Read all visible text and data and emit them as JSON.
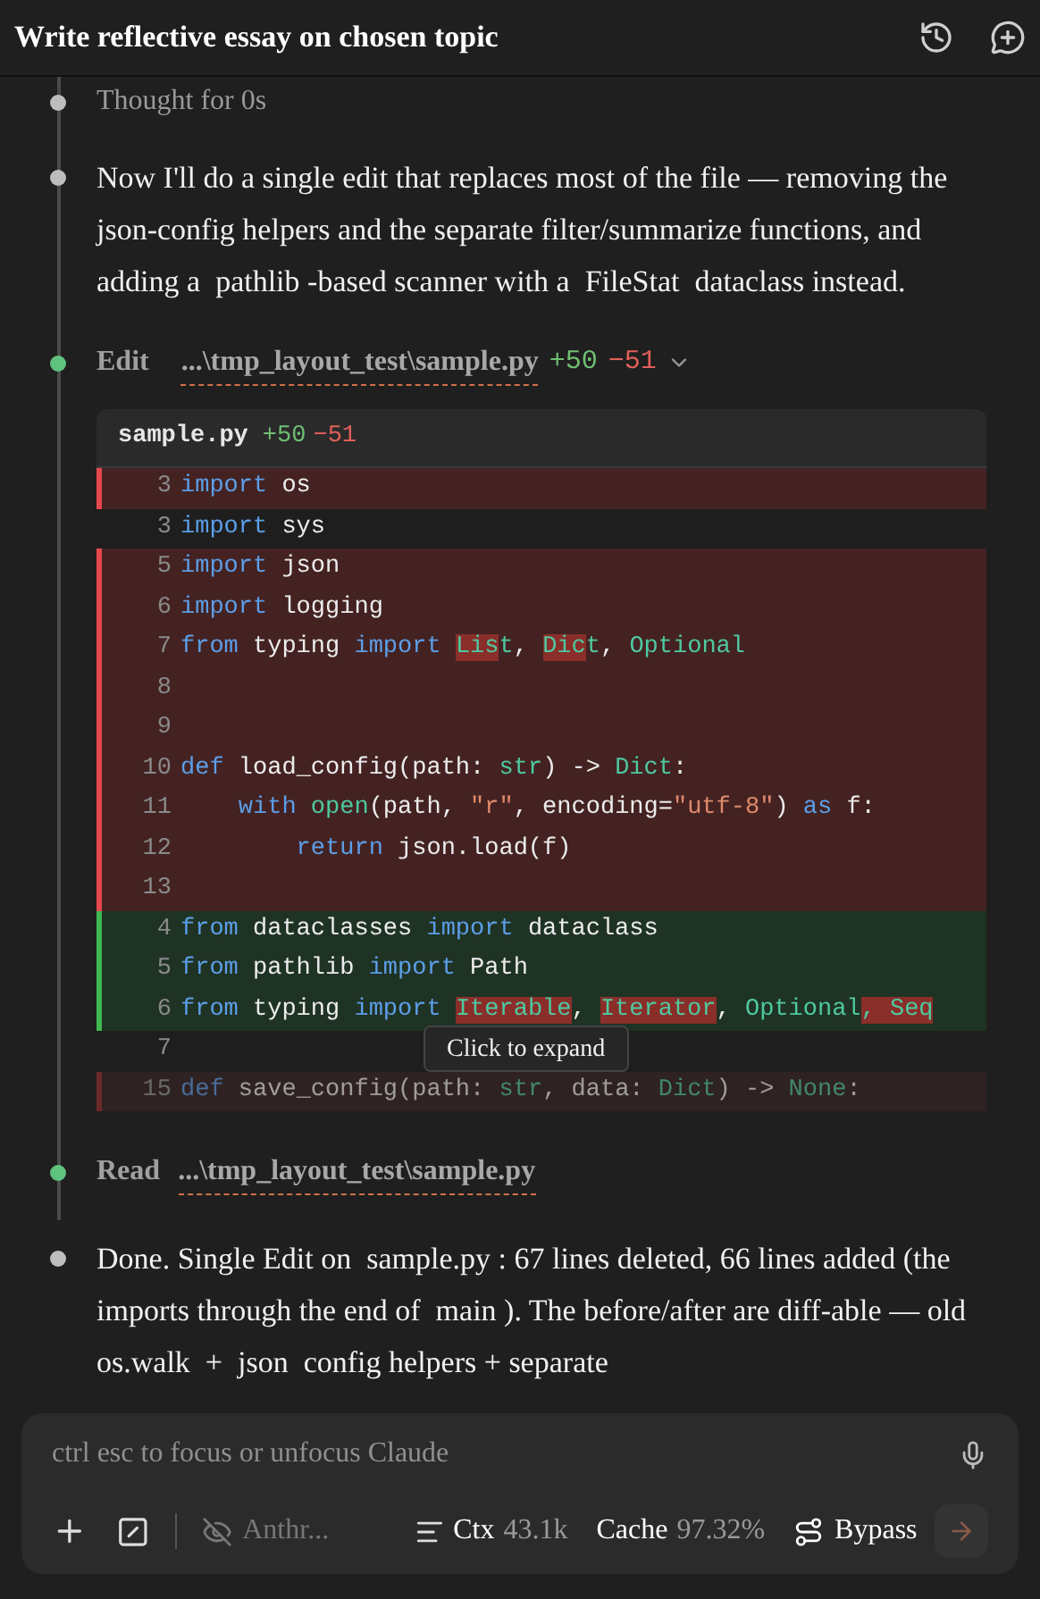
{
  "header": {
    "title": "Write reflective essay on chosen topic"
  },
  "timeline": [
    {
      "kind": "thought",
      "label": "Thought for 0s"
    },
    {
      "kind": "message",
      "text": "Now I'll do a single edit that replaces most of the file — removing the json-config helpers and the separate filter/summarize functions, and adding a  pathlib -based scanner with a  FileStat  dataclass instead."
    },
    {
      "kind": "edit",
      "action": "Edit",
      "path": "...\\tmp_layout_test\\sample.py",
      "added": "+50",
      "removed": "−51",
      "diff": {
        "file": "sample.py",
        "added": "+50",
        "removed": "−51",
        "expand_label": "Click to expand",
        "lines": [
          {
            "num": "3",
            "kind": "removed",
            "tokens": [
              {
                "text": "import",
                "kind": "kw"
              },
              {
                "text": " os",
                "kind": "txt"
              }
            ]
          },
          {
            "num": "3",
            "kind": "context",
            "tokens": [
              {
                "text": "import",
                "kind": "kw"
              },
              {
                "text": " sys",
                "kind": "txt"
              }
            ]
          },
          {
            "num": "5",
            "kind": "removed",
            "tokens": [
              {
                "text": "import",
                "kind": "kw"
              },
              {
                "text": " json",
                "kind": "txt"
              }
            ]
          },
          {
            "num": "6",
            "kind": "removed",
            "tokens": [
              {
                "text": "import",
                "kind": "kw"
              },
              {
                "text": " logging",
                "kind": "txt"
              }
            ]
          },
          {
            "num": "7",
            "kind": "removed",
            "tokens": [
              {
                "text": "from",
                "kind": "kw"
              },
              {
                "text": " typing ",
                "kind": "txt"
              },
              {
                "text": "import ",
                "kind": "kw"
              },
              {
                "text": "Lis",
                "kind": "hl"
              },
              {
                "text": "t",
                "kind": "ty"
              },
              {
                "text": ", ",
                "kind": "txt"
              },
              {
                "text": "Dic",
                "kind": "hl"
              },
              {
                "text": "t",
                "kind": "ty"
              },
              {
                "text": ", ",
                "kind": "txt"
              },
              {
                "text": "Optional",
                "kind": "ty"
              }
            ]
          },
          {
            "num": "8",
            "kind": "removed"
          },
          {
            "num": "9",
            "kind": "removed"
          },
          {
            "num": "10",
            "kind": "removed",
            "tokens": [
              {
                "text": "def",
                "kind": "kw"
              },
              {
                "text": " load_config(path: ",
                "kind": "txt"
              },
              {
                "text": "str",
                "kind": "ty"
              },
              {
                "text": ") -> ",
                "kind": "txt"
              },
              {
                "text": "Dict",
                "kind": "ty"
              },
              {
                "text": ":",
                "kind": "txt"
              }
            ]
          },
          {
            "num": "11",
            "kind": "removed",
            "tokens": [
              {
                "text": "    with",
                "kind": "kw"
              },
              {
                "text": " open",
                "kind": "ty"
              },
              {
                "text": "(path, ",
                "kind": "txt"
              },
              {
                "text": "\"r\"",
                "kind": "str"
              },
              {
                "text": ", encoding=",
                "kind": "txt"
              },
              {
                "text": "\"utf-8\"",
                "kind": "str"
              },
              {
                "text": ") ",
                "kind": "txt"
              },
              {
                "text": "as",
                "kind": "kw"
              },
              {
                "text": " f:",
                "kind": "txt"
              }
            ]
          },
          {
            "num": "12",
            "kind": "removed",
            "tokens": [
              {
                "text": "        return",
                "kind": "kw"
              },
              {
                "text": " json.load(f)",
                "kind": "txt"
              }
            ]
          },
          {
            "num": "13",
            "kind": "removed"
          },
          {
            "num": "4",
            "kind": "added",
            "tokens": [
              {
                "text": "from",
                "kind": "kw"
              },
              {
                "text": " dataclasses ",
                "kind": "txt"
              },
              {
                "text": "import",
                "kind": "kw"
              },
              {
                "text": " dataclass",
                "kind": "txt"
              }
            ]
          },
          {
            "num": "5",
            "kind": "added",
            "tokens": [
              {
                "text": "from",
                "kind": "kw"
              },
              {
                "text": " pathlib ",
                "kind": "txt"
              },
              {
                "text": "import",
                "kind": "kw"
              },
              {
                "text": " Path",
                "kind": "txt"
              }
            ]
          },
          {
            "num": "6",
            "kind": "added",
            "tokens": [
              {
                "text": "from",
                "kind": "kw"
              },
              {
                "text": " typing ",
                "kind": "txt"
              },
              {
                "text": "import ",
                "kind": "kw"
              },
              {
                "text": "Iterable",
                "kind": "hl"
              },
              {
                "text": ", ",
                "kind": "txt"
              },
              {
                "text": "Iterator",
                "kind": "hl"
              },
              {
                "text": ", ",
                "kind": "txt"
              },
              {
                "text": "Optional",
                "kind": "ty"
              },
              {
                "text": ", Seq",
                "kind": "hl"
              }
            ]
          },
          {
            "num": "7",
            "kind": "context"
          },
          {
            "num": "15",
            "kind": "faded",
            "tokens": [
              {
                "text": "def",
                "kind": "kw"
              },
              {
                "text": " save_config(path: ",
                "kind": "txt"
              },
              {
                "text": "str",
                "kind": "ty"
              },
              {
                "text": ", data: ",
                "kind": "txt"
              },
              {
                "text": "Dict",
                "kind": "ty"
              },
              {
                "text": ") -> ",
                "kind": "txt"
              },
              {
                "text": "None",
                "kind": "ty"
              },
              {
                "text": ":",
                "kind": "txt"
              }
            ]
          }
        ]
      }
    },
    {
      "kind": "read",
      "action": "Read",
      "path": "...\\tmp_layout_test\\sample.py"
    },
    {
      "kind": "message",
      "text": "Done. Single Edit on  sample.py : 67 lines deleted, 66 lines added (the imports through the end of  main ). The before/after are diff-able — old  os.walk  +  json  config helpers + separate"
    }
  ],
  "composer": {
    "placeholder": "ctrl esc to focus or unfocus Claude",
    "model": "Anthr...",
    "ctx_label": "Ctx",
    "ctx_value": "43.1k",
    "cache_label": "Cache",
    "cache_value": "97.32%",
    "mode": "Bypass"
  }
}
